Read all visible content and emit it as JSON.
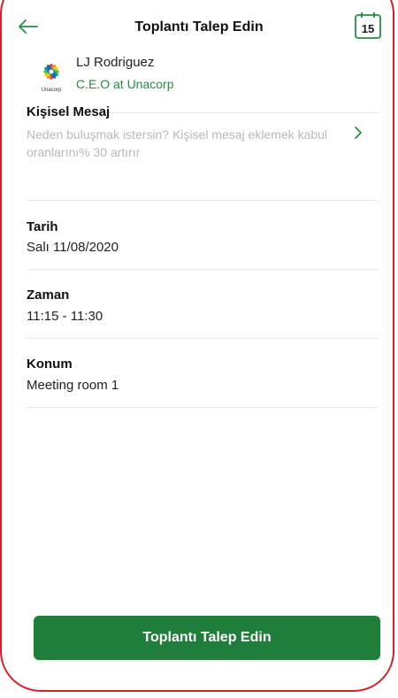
{
  "header": {
    "title": "Toplantı Talep Edin",
    "calendar_day": "15"
  },
  "contact": {
    "name": "LJ Rodriguez",
    "role": "C.E.O at Unacorp",
    "logo_text": "Unacorp"
  },
  "personal_message": {
    "label": "Kişisel Mesaj",
    "hint": "Neden buluşmak istersin? Kişisel mesaj eklemek kabul oranlarını% 30 artırır"
  },
  "date": {
    "label": "Tarih",
    "value": "Salı 11/08/2020"
  },
  "time": {
    "label": "Zaman",
    "value": "11:15 - 11:30"
  },
  "location": {
    "label": "Konum",
    "value": "Meeting room 1"
  },
  "cta": {
    "label": "Toplantı Talep Edin"
  },
  "colors": {
    "brand_green": "#1f7e3a",
    "link_green": "#2a8a4a",
    "frame_red": "#d6202c"
  }
}
